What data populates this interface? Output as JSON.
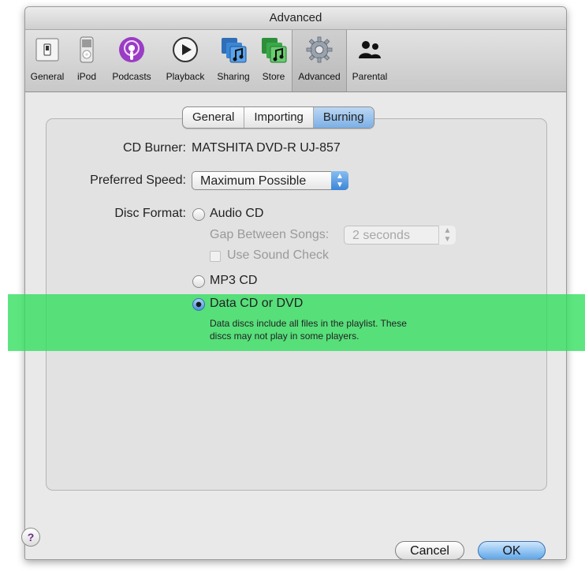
{
  "window": {
    "title": "Advanced"
  },
  "toolbar": {
    "items": [
      {
        "label": "General",
        "icon": "switch-icon"
      },
      {
        "label": "iPod",
        "icon": "ipod-icon"
      },
      {
        "label": "Podcasts",
        "icon": "podcast-icon"
      },
      {
        "label": "Playback",
        "icon": "play-icon"
      },
      {
        "label": "Sharing",
        "icon": "sharing-icon"
      },
      {
        "label": "Store",
        "icon": "store-icon"
      },
      {
        "label": "Advanced",
        "icon": "gear-icon",
        "selected": true
      },
      {
        "label": "Parental",
        "icon": "parental-icon"
      }
    ]
  },
  "tabs": [
    {
      "label": "General"
    },
    {
      "label": "Importing"
    },
    {
      "label": "Burning",
      "selected": true
    }
  ],
  "form": {
    "cd_burner_label": "CD Burner:",
    "cd_burner_value": "MATSHITA DVD-R   UJ-857",
    "preferred_speed_label": "Preferred Speed:",
    "preferred_speed_value": "Maximum Possible",
    "disc_format_label": "Disc Format:",
    "audio_cd_label": "Audio CD",
    "gap_label": "Gap Between Songs:",
    "gap_value": "2 seconds",
    "sound_check_label": "Use Sound Check",
    "mp3_cd_label": "MP3 CD",
    "data_cd_label": "Data CD or DVD",
    "data_cd_note_line1": "Data discs include all files in the playlist. These",
    "data_cd_note_line2": "discs may not play in some players.",
    "selected_format": "Data CD or DVD"
  },
  "buttons": {
    "help": "?",
    "cancel": "Cancel",
    "ok": "OK"
  },
  "colors": {
    "highlight": "#30de5c",
    "selected_tab": "#7cb0e6",
    "default_button": "#5ea6ea"
  }
}
